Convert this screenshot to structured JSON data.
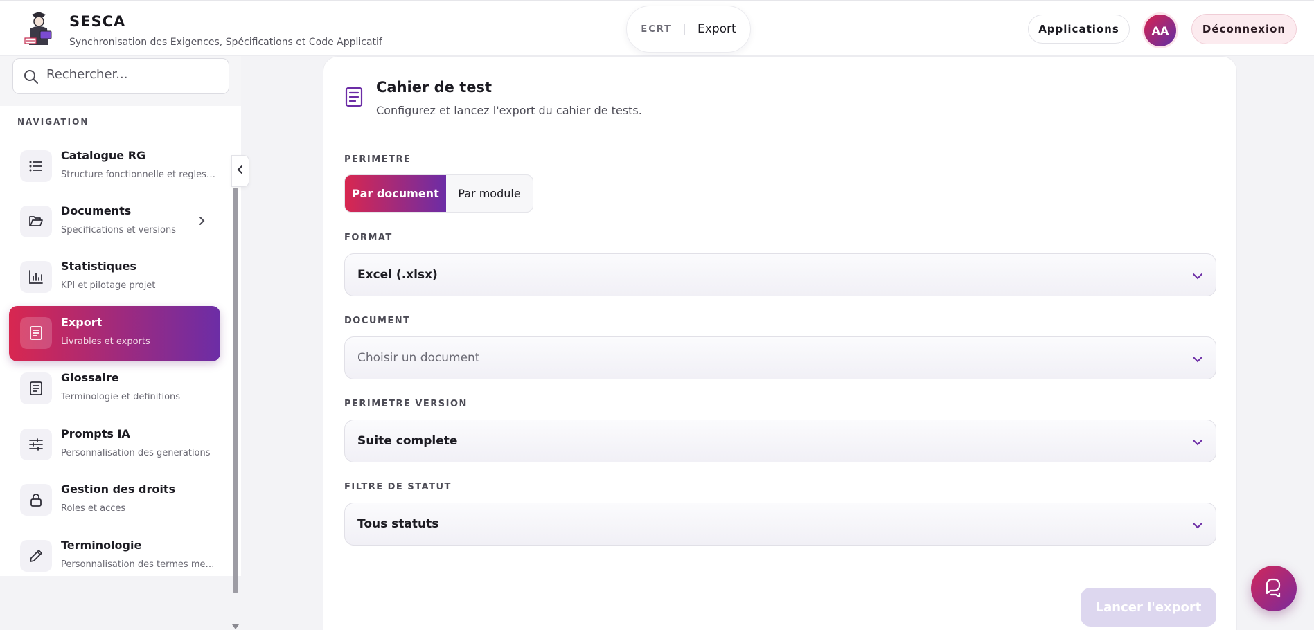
{
  "header": {
    "brand_title": "SESCA",
    "brand_subtitle": "Synchronisation des Exigences, Spécifications et Code Applicatif",
    "breadcrumb_app": "ECRT",
    "breadcrumb_page": "Export",
    "applications_label": "Applications",
    "avatar_initials": "AA",
    "logout_label": "Déconnexion"
  },
  "sidebar": {
    "search_placeholder": "Rechercher...",
    "section_title": "NAVIGATION",
    "items": [
      {
        "label": "Catalogue RG",
        "sub": "Structure fonctionnelle et regles metier",
        "icon": "list-icon"
      },
      {
        "label": "Documents",
        "sub": "Specifications et versions",
        "icon": "folder-icon"
      },
      {
        "label": "Statistiques",
        "sub": "KPI et pilotage projet",
        "icon": "bar-chart-icon"
      },
      {
        "label": "Export",
        "sub": "Livrables et exports",
        "icon": "document-icon",
        "active": true
      },
      {
        "label": "Glossaire",
        "sub": "Terminologie et definitions",
        "icon": "document-icon"
      },
      {
        "label": "Prompts IA",
        "sub": "Personnalisation des generations",
        "icon": "sliders-icon"
      },
      {
        "label": "Gestion des droits",
        "sub": "Roles et acces",
        "icon": "lock-icon"
      },
      {
        "label": "Terminologie",
        "sub": "Personnalisation des termes metier",
        "icon": "pencil-icon"
      }
    ]
  },
  "card": {
    "title": "Cahier de test",
    "subtitle": "Configurez et lancez l'export du cahier de tests.",
    "perimetre_label": "PERIMETRE",
    "perimetre_options": [
      "Par document",
      "Par module"
    ],
    "perimetre_selected": "Par document",
    "format_label": "FORMAT",
    "format_value": "Excel (.xlsx)",
    "document_label": "DOCUMENT",
    "document_placeholder": "Choisir un document",
    "version_label": "PERIMETRE VERSION",
    "version_value": "Suite complete",
    "statut_label": "FILTRE DE STATUT",
    "statut_value": "Tous statuts",
    "export_button": "Lancer l'export"
  },
  "colors": {
    "accent_start": "#d82750",
    "accent_end": "#6c2da6",
    "disabled_button": "#ddd7ef"
  }
}
